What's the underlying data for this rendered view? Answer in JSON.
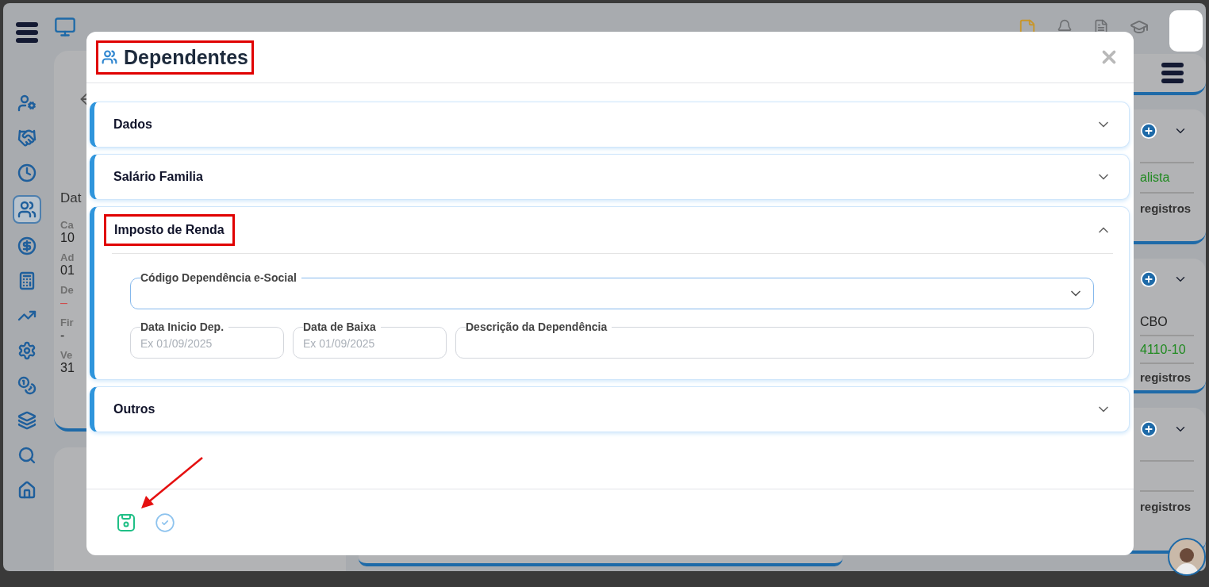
{
  "background": {
    "left_card": {
      "heading": "Dat",
      "fields": [
        {
          "label": "Ca",
          "value": "10",
          "alert": false
        },
        {
          "label": "Ad",
          "value": "01",
          "alert": false
        },
        {
          "label": "De",
          "value": "–",
          "alert": true
        },
        {
          "label": "Fir",
          "value": "-",
          "alert": false
        },
        {
          "label": "Ve",
          "value": "31",
          "alert": false
        }
      ]
    },
    "right_cards": [
      {
        "lines": [
          {
            "kind": "value",
            "text": "alista"
          },
          {
            "kind": "count",
            "text": "registros"
          }
        ]
      },
      {
        "lines": [
          {
            "kind": "label",
            "text": "CBO"
          },
          {
            "kind": "value",
            "text": "4110-10"
          },
          {
            "kind": "count",
            "text": "registros"
          }
        ]
      },
      {
        "lines": [
          {
            "kind": "blank"
          },
          {
            "kind": "count",
            "text": "registros"
          }
        ]
      }
    ]
  },
  "modal": {
    "title": "Dependentes",
    "title_highlighted": true,
    "sections": [
      {
        "title": "Dados",
        "expanded": false,
        "highlighted": false
      },
      {
        "title": "Salário Familia",
        "expanded": false,
        "highlighted": false
      },
      {
        "title": "Imposto de Renda",
        "expanded": true,
        "highlighted": true,
        "fields": [
          {
            "kind": "select",
            "label": "Código Dependência e-Social",
            "focused": true
          },
          {
            "kind": "date",
            "label": "Data Inicio Dep.",
            "placeholder": "Ex 01/09/2025",
            "focused": false
          },
          {
            "kind": "date",
            "label": "Data de Baixa",
            "placeholder": "Ex 01/09/2025",
            "focused": false
          },
          {
            "kind": "text",
            "label": "Descrição da Dependência",
            "focused": false
          }
        ]
      },
      {
        "title": "Outros",
        "expanded": false,
        "highlighted": false
      }
    ],
    "actions": [
      {
        "kind": "save",
        "pointed": true
      },
      {
        "kind": "confirm",
        "pointed": false
      }
    ]
  }
}
